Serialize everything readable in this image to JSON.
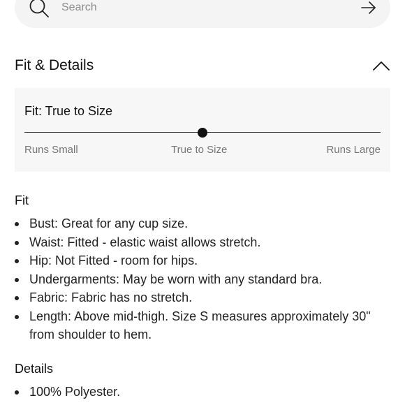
{
  "search": {
    "placeholder": "Search"
  },
  "section": {
    "title": "Fit & Details"
  },
  "fit": {
    "title": "Fit: True to Size",
    "scale_labels": [
      "Runs Small",
      "True to Size",
      "Runs Large"
    ],
    "selected_position": 0.5
  },
  "fit_section": {
    "heading": "Fit",
    "items": [
      "Bust: Great for any cup size.",
      "Waist: Fitted - elastic waist allows stretch.",
      "Hip: Not Fitted - room for hips.",
      "Undergarments: May be worn with any standard bra.",
      "Fabric: Fabric has no stretch.",
      "Length: Above mid-thigh. Size S measures approximately 30\" from shoulder to hem."
    ]
  },
  "details_section": {
    "heading": "Details",
    "items": [
      "100% Polyester."
    ]
  }
}
